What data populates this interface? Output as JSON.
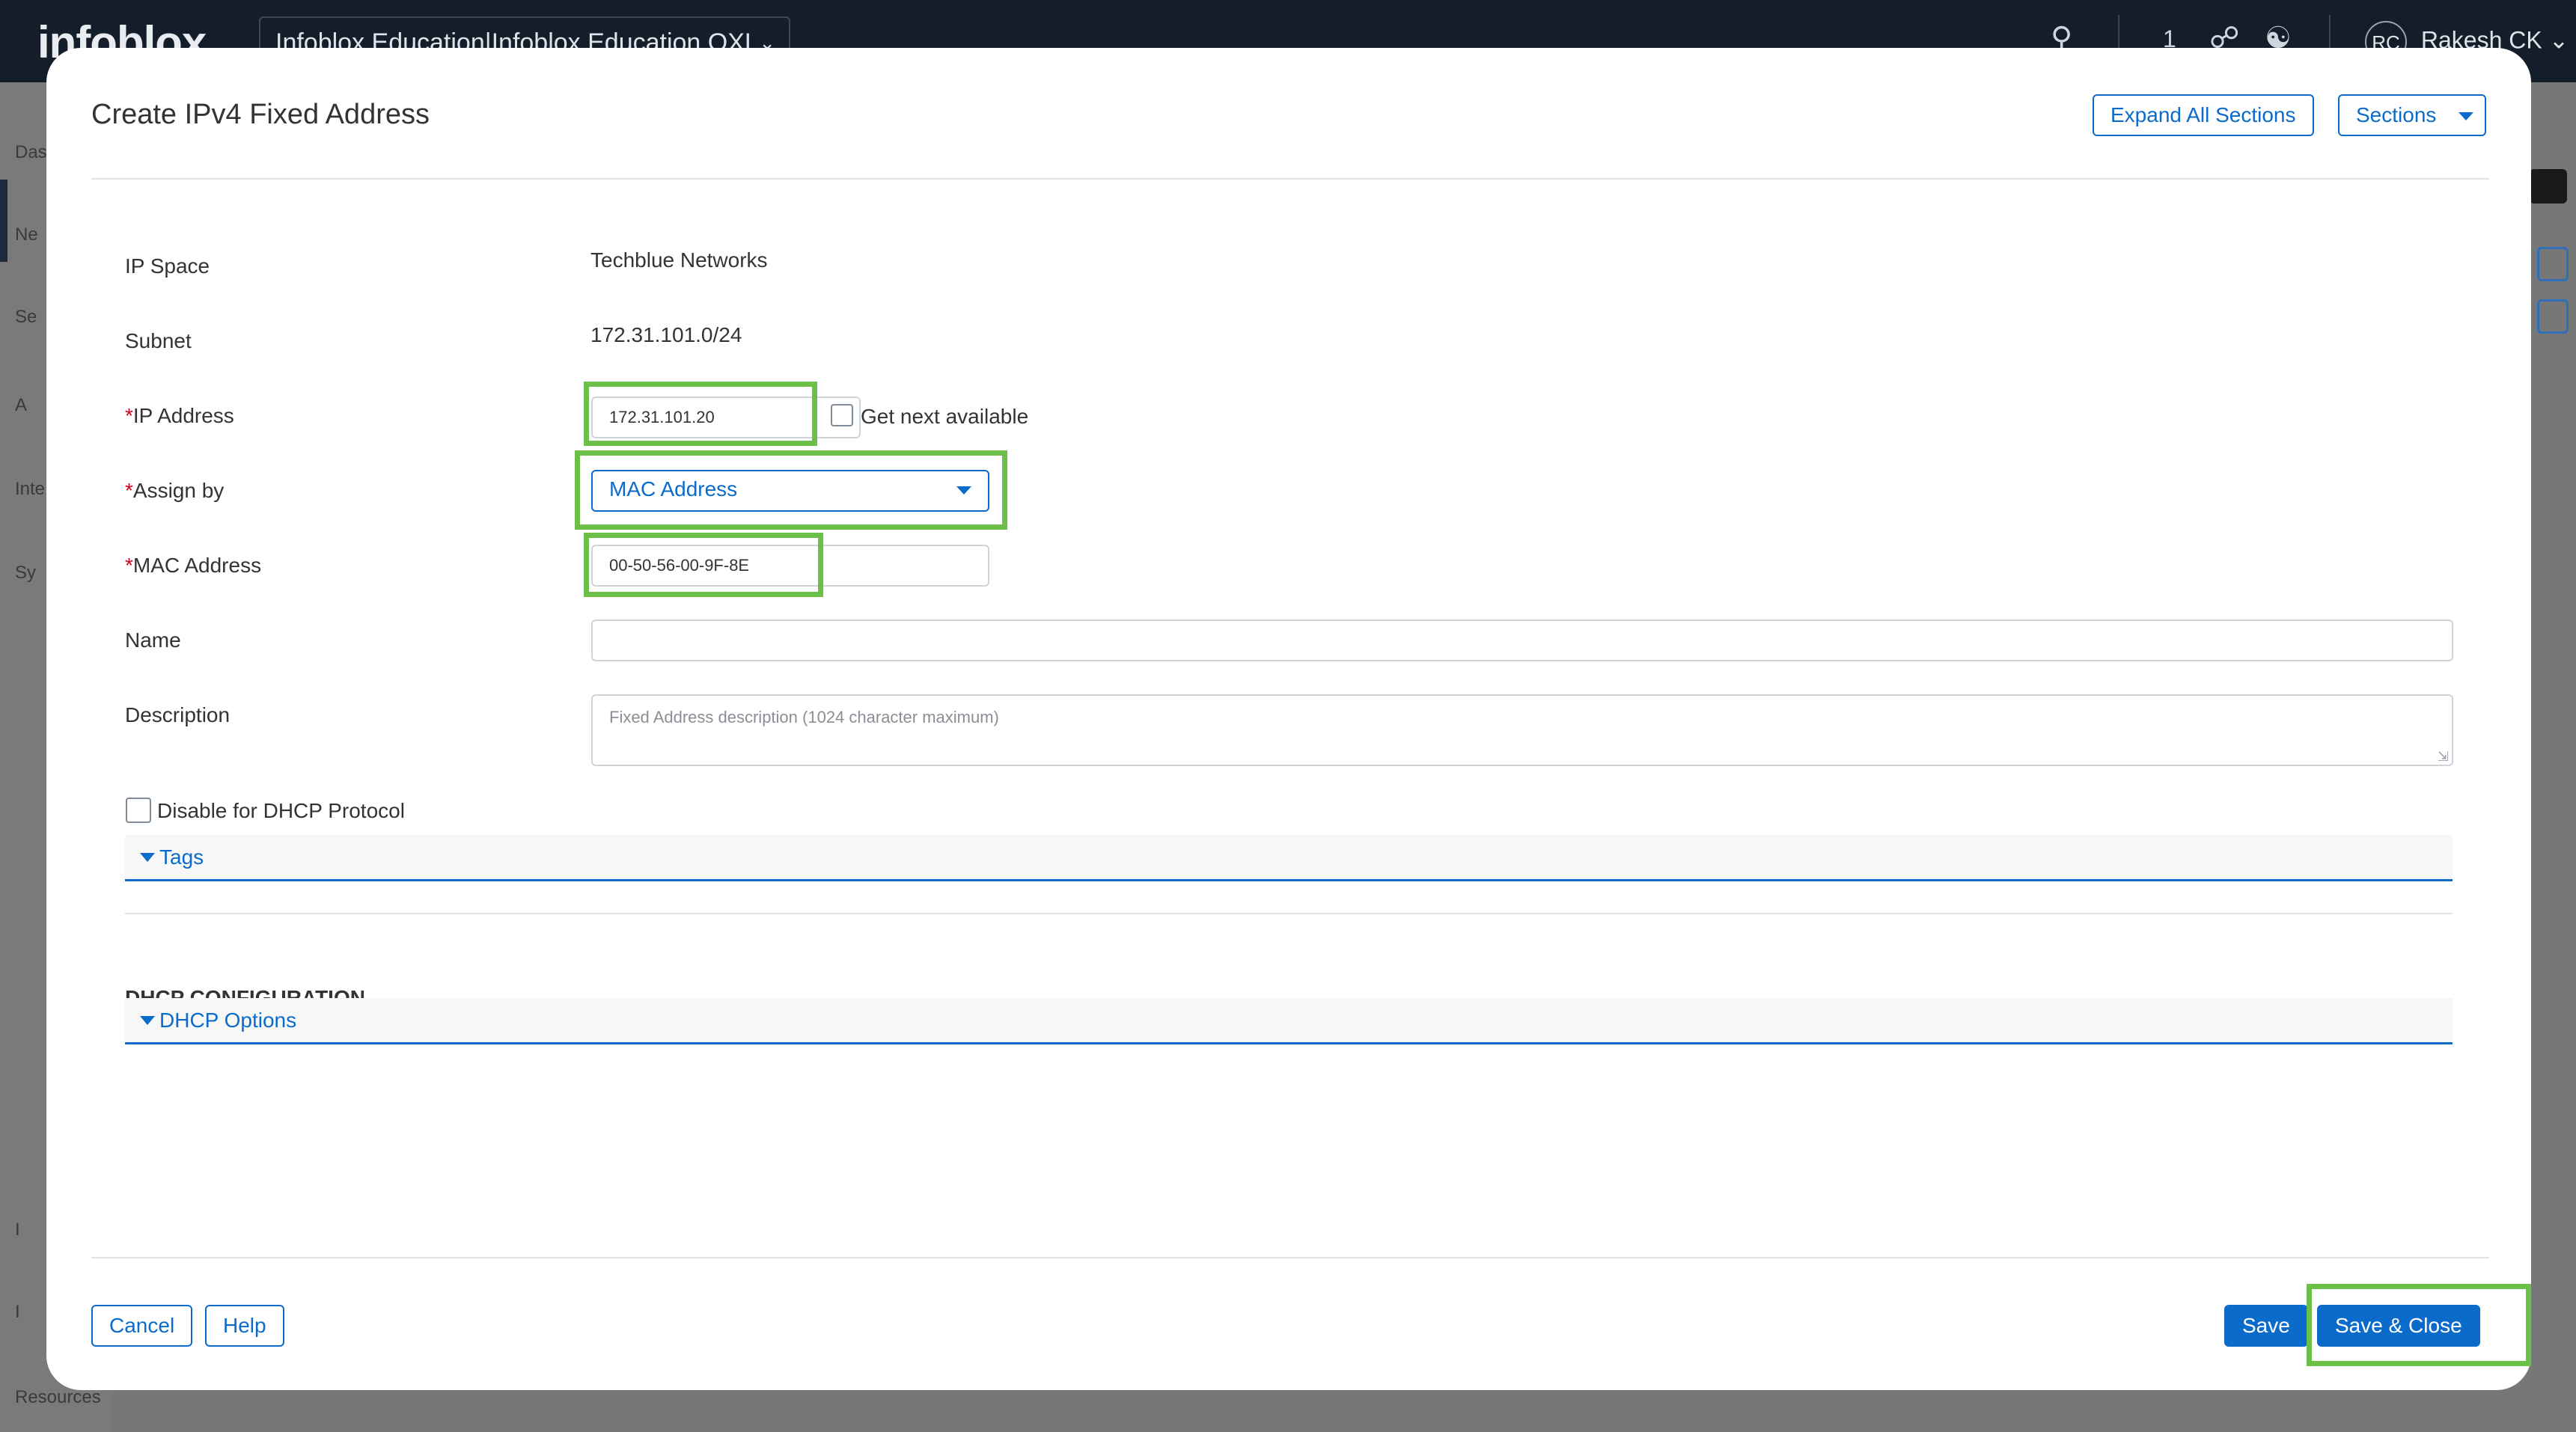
{
  "app": {
    "logo": "infoblox",
    "org_selector": "Infoblox Education|Infoblox Education OXL",
    "notifications_count": "1",
    "user_initials": "RC",
    "user_name": "Rakesh CK",
    "sidebar": [
      "Das",
      "Ne",
      "Se",
      "A",
      "Inte",
      "Sy",
      "I",
      "I",
      "Resources"
    ]
  },
  "modal": {
    "title": "Create IPv4 Fixed Address",
    "expand_all_label": "Expand All Sections",
    "sections_label": "Sections",
    "fields": {
      "ip_space": {
        "label": "IP Space",
        "value": "Techblue Networks"
      },
      "subnet": {
        "label": "Subnet",
        "value": "172.31.101.0/24"
      },
      "ip_address": {
        "required_mark": "*",
        "label": "IP Address",
        "value": "172.31.101.20",
        "next_available_label": "Get next available"
      },
      "assign_by": {
        "required_mark": "*",
        "label": "Assign by",
        "value": "MAC Address"
      },
      "mac_address": {
        "required_mark": "*",
        "label": "MAC Address",
        "value": "00-50-56-00-9F-8E"
      },
      "name": {
        "label": "Name",
        "value": ""
      },
      "description": {
        "label": "Description",
        "placeholder": "Fixed Address description (1024 character maximum)"
      },
      "disable_dhcp": {
        "label": "Disable for DHCP Protocol"
      }
    },
    "tags_section": "Tags",
    "dhcp_heading": "DHCP CONFIGURATION",
    "dhcp_options_section": "DHCP Options",
    "footer": {
      "cancel": "Cancel",
      "help": "Help",
      "save": "Save",
      "save_close": "Save & Close"
    }
  },
  "colors": {
    "accent": "#0b6bcb",
    "highlight": "#6cc04a",
    "required": "#d0021b"
  }
}
